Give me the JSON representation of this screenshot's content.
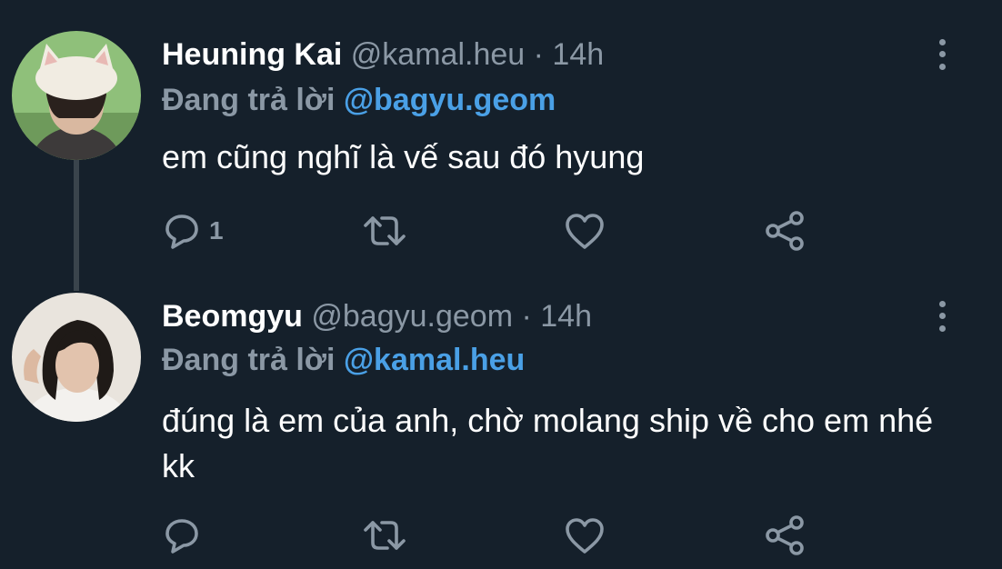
{
  "tweets": [
    {
      "name": "Heuning Kai",
      "handle": "@kamal.heu",
      "separator": "·",
      "time": "14h",
      "reply_label": "Đang trả lời",
      "reply_to": "@bagyu.geom",
      "text": "em cũng nghĩ là vế sau đó hyung",
      "reply_count": "1",
      "icons": [
        "comment-icon",
        "retweet-icon",
        "heart-icon",
        "share-icon",
        "more-options-icon"
      ]
    },
    {
      "name": "Beomgyu",
      "handle": "@bagyu.geom",
      "separator": "·",
      "time": "14h",
      "reply_label": "Đang trả lời",
      "reply_to": "@kamal.heu",
      "text": "đúng là em của anh, chờ molang ship về cho em nhé kk",
      "reply_count": "",
      "icons": [
        "comment-icon",
        "retweet-icon",
        "heart-icon",
        "share-icon",
        "more-options-icon"
      ]
    }
  ],
  "colors": {
    "background": "#15202b",
    "text": "#ffffff",
    "muted": "#8b98a5",
    "link": "#4aa0e6",
    "thread_line": "#3a444c"
  }
}
